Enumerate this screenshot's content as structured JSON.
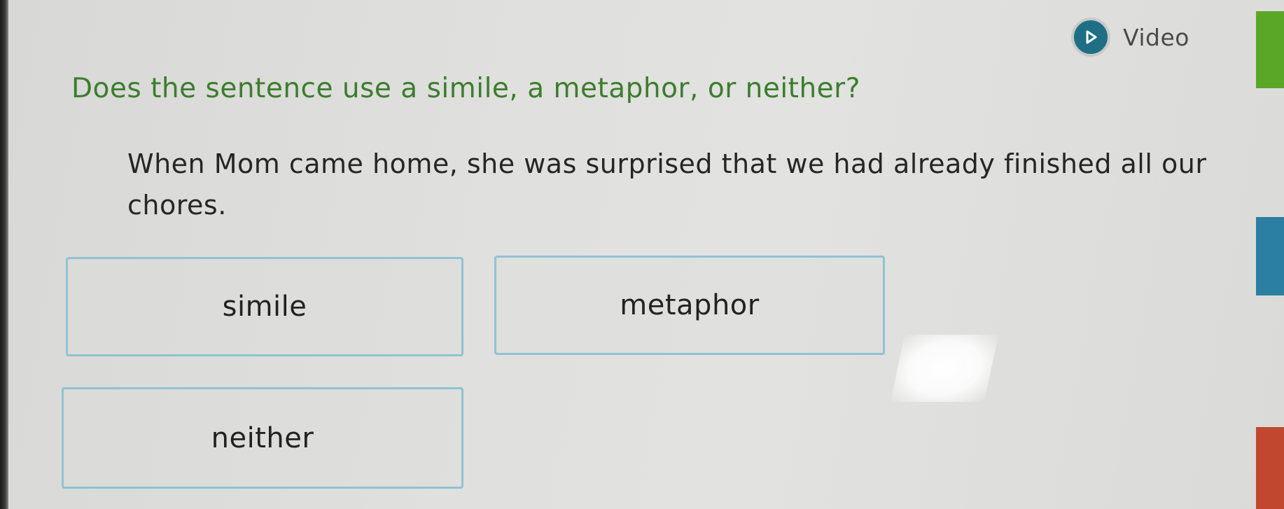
{
  "header": {
    "video_label": "Video"
  },
  "prompt": {
    "question": "Does the sentence use a simile, a metaphor, or neither?",
    "sentence": "When Mom came home, she was surprised that we had already finished all our chores."
  },
  "choices": [
    {
      "label": "simile"
    },
    {
      "label": "metaphor"
    },
    {
      "label": "neither"
    }
  ],
  "colors": {
    "question_text": "#3c7d2e",
    "video_icon": "#1e6f86",
    "choice_border": "#8fc3d3",
    "side_tab_top": "#5aa728",
    "side_tab_middle": "#2b7fa1",
    "side_tab_bottom": "#c1472f"
  }
}
